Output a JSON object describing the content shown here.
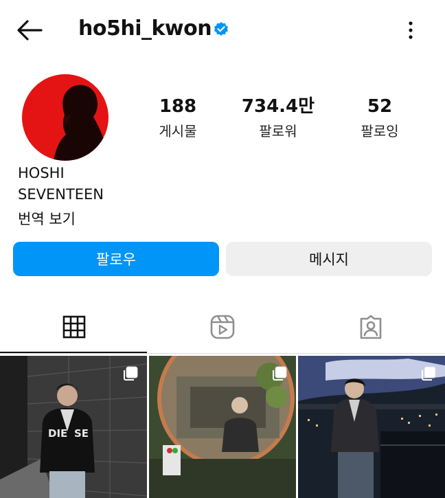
{
  "header": {
    "username": "ho5hi_kwon",
    "icons": [
      "back-arrow-icon",
      "verified-badge-icon",
      "more-options-icon"
    ],
    "verified_color": "#0095f6"
  },
  "stats": [
    {
      "value": "188",
      "label": "게시물"
    },
    {
      "value": "734.4만",
      "label": "팔로워"
    },
    {
      "value": "52",
      "label": "팔로잉"
    }
  ],
  "bio": {
    "name": "HOSHI",
    "line2": "SEVENTEEN",
    "translate": "번역 보기"
  },
  "buttons": {
    "follow": "팔로우",
    "message": "메시지",
    "follow_color": "#0095f6"
  },
  "tabs": [
    {
      "name": "posts",
      "icon": "grid-icon",
      "active": true
    },
    {
      "name": "reels",
      "icon": "reels-icon",
      "active": false
    },
    {
      "name": "tagged",
      "icon": "tagged-person-icon",
      "active": false
    }
  ],
  "posts": [
    {
      "type": "carousel",
      "icon": "multiple-photos-icon"
    },
    {
      "type": "carousel",
      "icon": "multiple-photos-icon"
    },
    {
      "type": "carousel",
      "icon": "multiple-photos-icon"
    }
  ]
}
